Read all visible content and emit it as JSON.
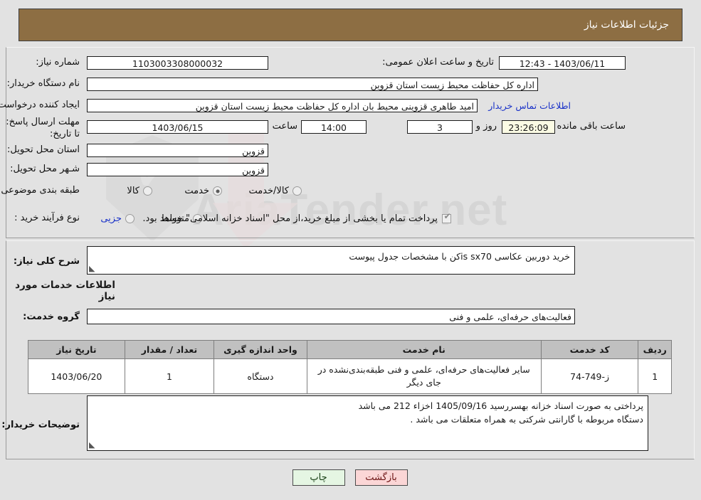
{
  "header": {
    "title": "جزئیات اطلاعات نیاز"
  },
  "watermark": {
    "text": "AriaTender.net"
  },
  "form": {
    "need_number_label": "شماره نیاز:",
    "need_number_value": "1103003308000032",
    "announce_datetime_label": "تاریخ و ساعت اعلان عمومی:",
    "announce_datetime_value": "1403/06/11 - 12:43",
    "buyer_org_label": "نام دستگاه خریدار:",
    "buyer_org_value": "اداره کل حفاظت محیط زیست استان قزوین",
    "requester_label": "ایجاد کننده درخواست:",
    "requester_value": "امید طاهری قزوینی محیط بان اداره کل حفاظت محیط زیست استان قزوین",
    "buyer_contact_link": "اطلاعات تماس خریدار",
    "deadline_label": "مهلت ارسال پاسخ: تا تاریخ:",
    "deadline_date": "1403/06/15",
    "deadline_time_label": "ساعت",
    "deadline_time": "14:00",
    "days_value": "3",
    "days_label": "روز و",
    "remaining_time": "23:26:09",
    "remaining_label": "ساعت باقی مانده",
    "province_label": "استان محل تحویل:",
    "province_value": "قزوین",
    "city_label": "شـهر محل تحویل:",
    "city_value": "قزوین",
    "category_label": "طبقه بندی موضوعی:",
    "category_options": [
      "کالا",
      "خدمت",
      "کالا/خدمت"
    ],
    "category_selected": "خدمت",
    "purchase_type_label": "نوع فرآیند خرید :",
    "purchase_type_options": [
      "جزیی",
      "متوسط"
    ],
    "purchase_type_selected": "",
    "treasury_checkbox_checked": true,
    "treasury_note": "پرداخت تمام یا بخشی از مبلغ خرید،از محل \"اسناد خزانه اسلامی\" خواهد بود."
  },
  "description": {
    "label": "شرح کلی نیاز:",
    "value": "خرید دوربین عکاسی is sx70کن با مشخصات جدول پیوست"
  },
  "services_section": {
    "heading": "اطلاعات خدمات مورد نیاز",
    "group_label": "گروه خدمت:",
    "group_value": "فعالیت‌های حرفه‌ای، علمی و فنی"
  },
  "table": {
    "columns": [
      "ردیف",
      "کد خدمت",
      "نام خدمت",
      "واحد اندازه گیری",
      "تعداد / مقدار",
      "تاریخ نیاز"
    ],
    "rows": [
      {
        "index": "1",
        "code": "ز-749-74",
        "name": "سایر فعالیت‌های حرفه‌ای، علمی و فنی طبقه‌بندی‌نشده در جای دیگر",
        "unit": "دستگاه",
        "qty": "1",
        "date": "1403/06/20"
      }
    ]
  },
  "buyer_notes": {
    "label": "توضیحات خریدار:",
    "line1": "پرداختی به صورت اسناد خزانه بهسررسید 1405/09/16 اخزاء 212 می باشد",
    "line2": "دستگاه مربوطه با گارانتی شرکتی به همراه متعلقات می باشد ."
  },
  "buttons": {
    "print": "چاپ",
    "back": "بازگشت"
  },
  "colors": {
    "header_brown": "#8d6e43",
    "link_blue": "#1a32c8",
    "print_green": "#e5f6e3",
    "back_pink": "#fbd6d6",
    "countdown_bg": "#fbfbe4",
    "table_header": "#c0c0c0",
    "page_bg": "#e2e2e2"
  }
}
